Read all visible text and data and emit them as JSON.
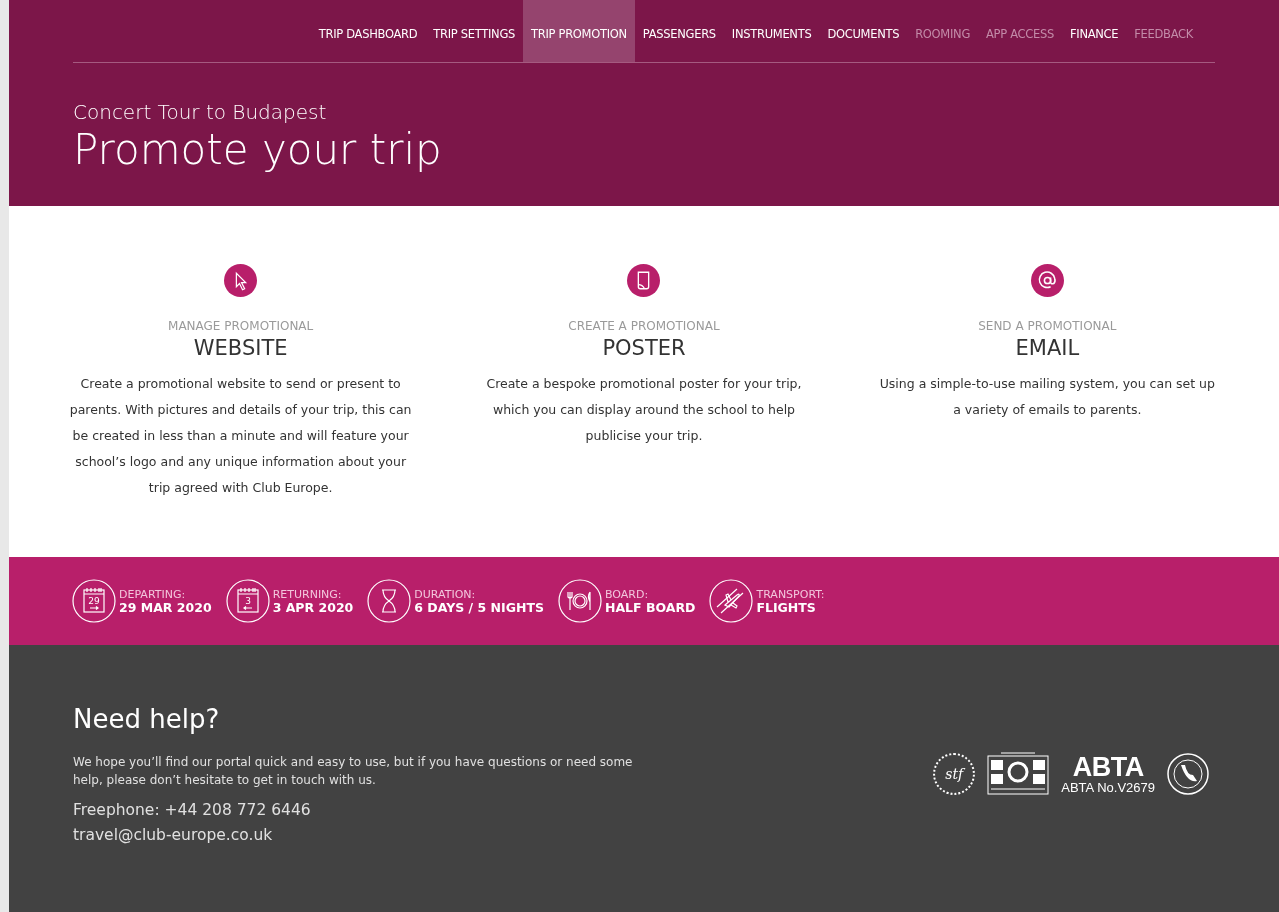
{
  "nav": [
    {
      "label": "TRIP DASHBOARD",
      "selected": false,
      "disabled": false
    },
    {
      "label": "TRIP SETTINGS",
      "selected": false,
      "disabled": false
    },
    {
      "label": "TRIP PROMOTION",
      "selected": true,
      "disabled": false
    },
    {
      "label": "PASSENGERS",
      "selected": false,
      "disabled": false
    },
    {
      "label": "INSTRUMENTS",
      "selected": false,
      "disabled": false
    },
    {
      "label": "DOCUMENTS",
      "selected": false,
      "disabled": false
    },
    {
      "label": "ROOMING",
      "selected": false,
      "disabled": true
    },
    {
      "label": "APP ACCESS",
      "selected": false,
      "disabled": true
    },
    {
      "label": "FINANCE",
      "selected": false,
      "disabled": false
    },
    {
      "label": "FEEDBACK",
      "selected": false,
      "disabled": true
    }
  ],
  "header": {
    "subtitle": "Concert Tour to Budapest",
    "title": "Promote your trip"
  },
  "features": [
    {
      "kind": "cursor",
      "overline": "MANAGE PROMOTIONAL",
      "title": "WEBSITE",
      "text": "Create a promotional website to send or present to parents. With pictures and details of your trip, this can be created in less than a minute and will feature your school’s logo and any unique information about your trip agreed with Club Europe."
    },
    {
      "kind": "poster",
      "overline": "CREATE A PROMOTIONAL",
      "title": "POSTER",
      "text": "Create a bespoke promotional poster for your trip, which you can display around the school to help publicise your trip."
    },
    {
      "kind": "email",
      "overline": "SEND A PROMOTIONAL",
      "title": "EMAIL",
      "text": "Using a simple-to-use mailing system, you can set up a variety of emails to parents."
    }
  ],
  "trip_info": [
    {
      "kind": "departing",
      "icon_text": "29",
      "label": "DEPARTING:",
      "value": "29 MAR 2020"
    },
    {
      "kind": "returning",
      "icon_text": "3",
      "label": "RETURNING:",
      "value": "3 APR 2020"
    },
    {
      "kind": "duration",
      "label": "DURATION:",
      "value": "6 DAYS / 5 NIGHTS"
    },
    {
      "kind": "board",
      "label": "BOARD:",
      "value": "HALF BOARD"
    },
    {
      "kind": "transport",
      "label": "TRANSPORT:",
      "value": "FLIGHTS"
    }
  ],
  "help": {
    "title": "Need help?",
    "text": "We hope you’ll find our portal quick and easy to use, but if you have questions or need some help, please don’t hesitate to get in touch with us.",
    "phone": "Freephone: +44 208 772 6446",
    "email": "travel@club-europe.co.uk"
  },
  "badges": {
    "stf": "stf",
    "abta": "ABTA",
    "abta_number": "ABTA No.V2679"
  }
}
